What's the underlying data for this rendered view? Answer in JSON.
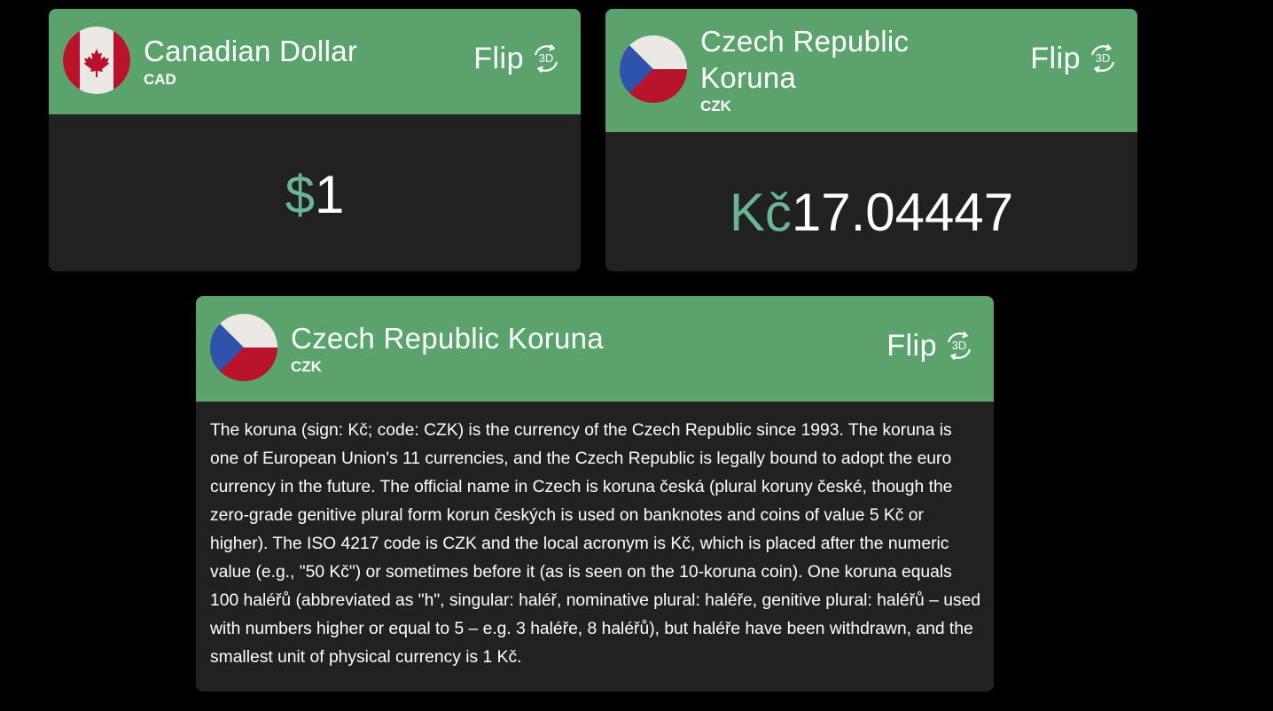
{
  "colors": {
    "header_green": "#5aa36c",
    "card_body": "#21221f",
    "background": "#000000",
    "symbol_teal": "#6ab596"
  },
  "cards": [
    {
      "currency_name": "Canadian Dollar",
      "currency_code": "CAD",
      "flip_label": "Flip",
      "flip_icon": "3d-rotate-icon",
      "flag_icon": "canada-flag-icon",
      "symbol": "$",
      "amount": "1"
    },
    {
      "currency_name": "Czech Republic Koruna",
      "currency_code": "CZK",
      "flip_label": "Flip",
      "flip_icon": "3d-rotate-icon",
      "flag_icon": "czech-flag-icon",
      "symbol": "Kč",
      "amount": "17.04447"
    },
    {
      "currency_name": "Czech Republic Koruna",
      "currency_code": "CZK",
      "flip_label": "Flip",
      "flip_icon": "3d-rotate-icon",
      "flag_icon": "czech-flag-icon",
      "description": "The koruna (sign: Kč; code: CZK) is the currency of the Czech Republic since 1993. The koruna is one of European Union's 11 currencies, and the Czech Republic is legally bound to adopt the euro currency in the future. The official name in Czech is koruna česká (plural koruny české, though the zero-grade genitive plural form korun českých is used on banknotes and coins of value 5 Kč or higher). The ISO 4217 code is CZK and the local acronym is Kč, which is placed after the numeric value (e.g., \"50 Kč\") or sometimes before it (as is seen on the 10-koruna coin). One koruna equals 100 haléřů (abbreviated as \"h\", singular: haléř, nominative plural: haléře, genitive plural: haléřů – used with numbers higher or equal to 5 – e.g. 3 haléře, 8 haléřů), but haléře have been withdrawn, and the smallest unit of physical currency is 1 Kč."
    }
  ]
}
